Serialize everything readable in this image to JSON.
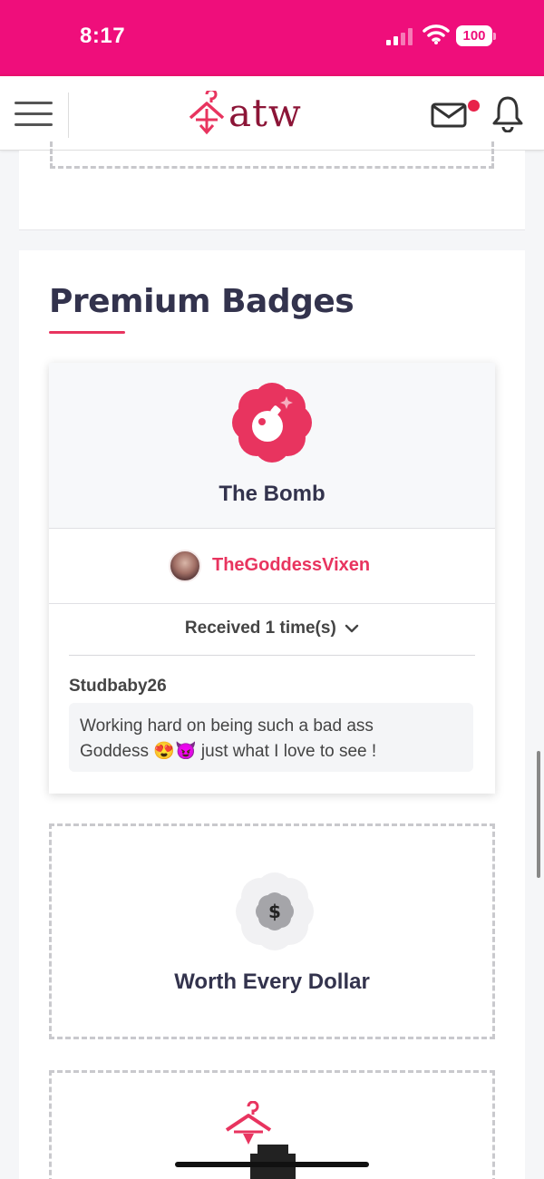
{
  "status_bar": {
    "time": "8:17",
    "battery": "100",
    "accent_color": "#ef0e7b"
  },
  "nav": {
    "logo_text": "atw",
    "menu_icon": "hamburger-icon",
    "mail_icon": "mail-icon",
    "notification_icon": "bell-icon"
  },
  "section": {
    "title": "Premium Badges"
  },
  "badges": [
    {
      "name": "The Bomb",
      "icon": "bomb-icon",
      "giver": "TheGoddessVixen",
      "received_label": "Received 1 time(s)",
      "comments": [
        {
          "sender": "Studbaby26",
          "message_line1": "Working hard on being such a bad ass",
          "message_line2": "Goddess 😍😈 just what I love to see !"
        }
      ]
    },
    {
      "name": "Worth Every Dollar",
      "icon": "dollar-icon"
    }
  ]
}
